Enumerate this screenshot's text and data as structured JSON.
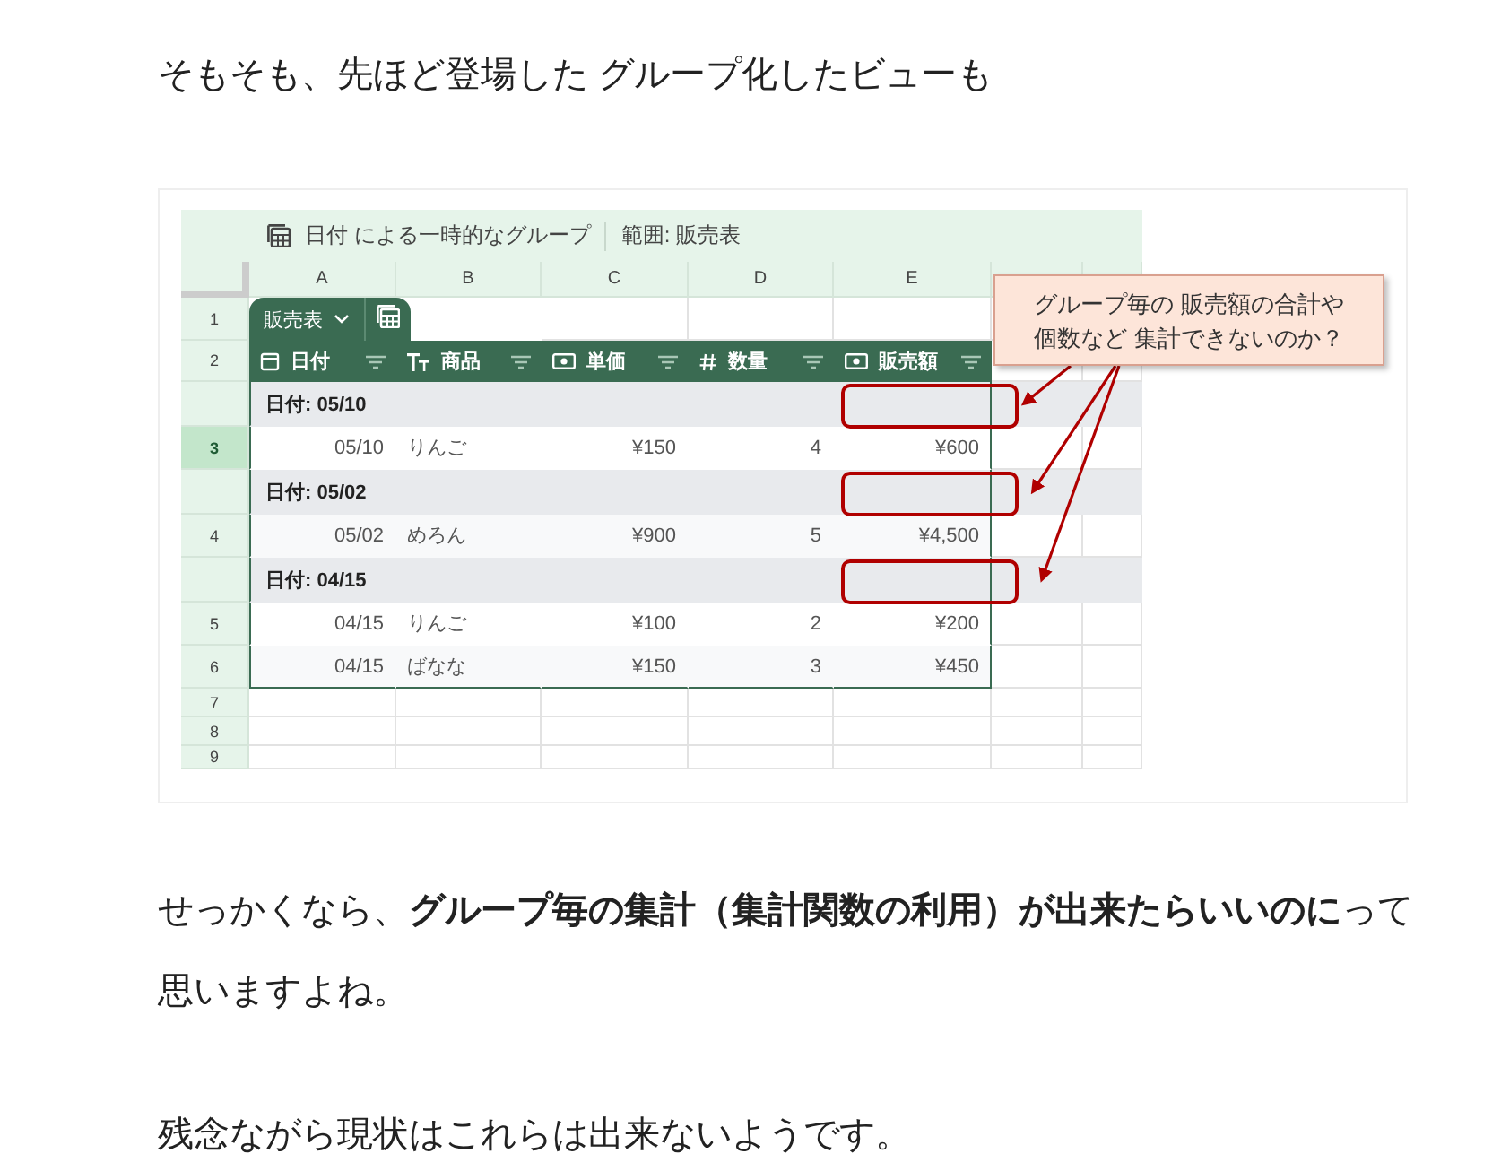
{
  "intro": "そもそも、先ほど登場した グループ化したビューも",
  "sheet": {
    "toolbar": {
      "group_label": "日付 による一時的なグループ",
      "range_label": "範囲:  販売表"
    },
    "column_letters": [
      "A",
      "B",
      "C",
      "D",
      "E"
    ],
    "header_row_numbers": [
      "1",
      "2"
    ],
    "table_tab": "販売表",
    "columns": [
      {
        "label": "日付",
        "kind": "date"
      },
      {
        "label": "商品",
        "kind": "text"
      },
      {
        "label": "単価",
        "kind": "money"
      },
      {
        "label": "数量",
        "kind": "number"
      },
      {
        "label": "販売額",
        "kind": "money"
      }
    ],
    "rows": [
      {
        "kind": "group",
        "label": "日付: 05/10"
      },
      {
        "kind": "data",
        "number": "3",
        "selected": true,
        "cells": [
          "05/10",
          "りんご",
          "¥150",
          "4",
          "¥600"
        ]
      },
      {
        "kind": "group",
        "label": "日付: 05/02"
      },
      {
        "kind": "data",
        "number": "4",
        "selected": false,
        "cells": [
          "05/02",
          "めろん",
          "¥900",
          "5",
          "¥4,500"
        ]
      },
      {
        "kind": "group",
        "label": "日付: 04/15"
      },
      {
        "kind": "data",
        "number": "5",
        "selected": false,
        "cells": [
          "04/15",
          "りんご",
          "¥100",
          "2",
          "¥200"
        ]
      },
      {
        "kind": "data",
        "number": "6",
        "selected": false,
        "cells": [
          "04/15",
          "ばなな",
          "¥150",
          "3",
          "¥450"
        ]
      }
    ],
    "empty_rows": [
      "7",
      "8",
      "9"
    ]
  },
  "callout": {
    "lines": [
      "グループ毎の 販売額の合計や",
      "個数など 集計できないのか？"
    ]
  },
  "paragraphs": [
    "せっかくなら、**グループ毎の集計（集計関数の利用）が出来たらいいのに**って思いますよね。",
    "残念ながら現状はこれらは出来ないようです。"
  ]
}
